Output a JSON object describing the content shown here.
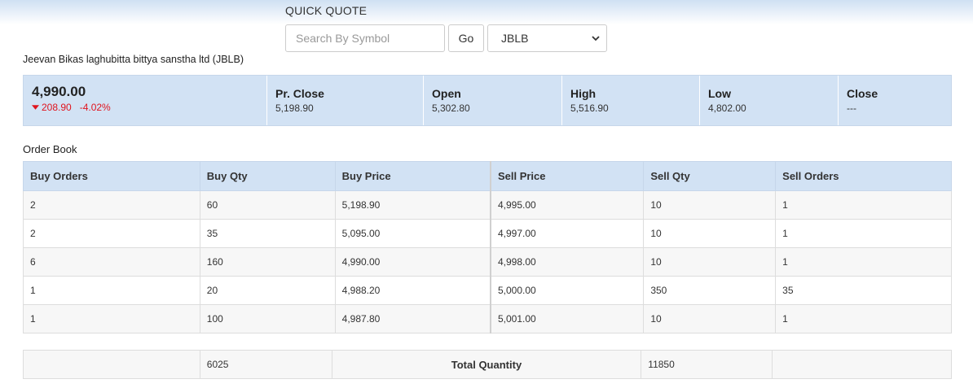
{
  "quick_quote": {
    "title": "QUICK QUOTE",
    "search_placeholder": "Search By Symbol",
    "go_label": "Go",
    "selected_symbol": "JBLB"
  },
  "company": {
    "name": "Jeevan Bikas laghubitta bittya sanstha ltd (JBLB)"
  },
  "quote": {
    "ltp": "4,990.00",
    "change": "208.90",
    "change_pct": "-4.02%",
    "change_color": "#e0141e",
    "pr_close_label": "Pr. Close",
    "pr_close": "5,198.90",
    "open_label": "Open",
    "open": "5,302.80",
    "high_label": "High",
    "high": "5,516.90",
    "low_label": "Low",
    "low": "4,802.00",
    "close_label": "Close",
    "close": "---"
  },
  "order_book": {
    "title": "Order Book",
    "headers": [
      "Buy Orders",
      "Buy Qty",
      "Buy Price",
      "Sell Price",
      "Sell Qty",
      "Sell Orders"
    ],
    "rows": [
      [
        "2",
        "60",
        "5,198.90",
        "4,995.00",
        "10",
        "1"
      ],
      [
        "2",
        "35",
        "5,095.00",
        "4,997.00",
        "10",
        "1"
      ],
      [
        "6",
        "160",
        "4,990.00",
        "4,998.00",
        "10",
        "1"
      ],
      [
        "1",
        "20",
        "4,988.20",
        "5,000.00",
        "350",
        "35"
      ],
      [
        "1",
        "100",
        "4,987.80",
        "5,001.00",
        "10",
        "1"
      ]
    ],
    "total_buy_qty": "6025",
    "total_label": "Total Quantity",
    "total_sell_qty": "11850"
  },
  "colors": {
    "header_bg": "#d2e2f4",
    "negative": "#e0141e"
  }
}
